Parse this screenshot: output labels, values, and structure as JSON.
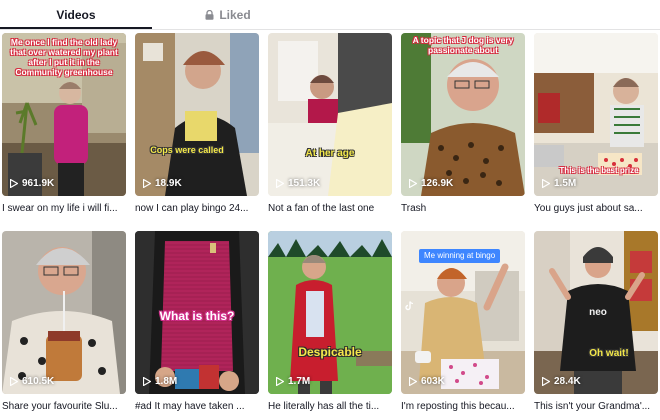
{
  "tabs": {
    "videos_label": "Videos",
    "liked_label": "Liked"
  },
  "colors": {
    "text": "#161823",
    "muted": "#8a8b91",
    "divider": "#e3e3e4",
    "caption_red": "#d6293e",
    "caption_yellow": "#f3e84a",
    "caption_pink": "#d12c8a",
    "pill_blue": "#3e86ff"
  },
  "videos": [
    {
      "caption": "Me once I find the old lady that over watered my plant after I put it in the Community greenhouse",
      "views": "961.9K",
      "title": "I swear on my life i will fi..."
    },
    {
      "caption": "Cops were called",
      "views": "18.9K",
      "title": "now I can play bingo 24..."
    },
    {
      "caption": "At her age",
      "views": "151.3K",
      "title": "Not a fan of the last one"
    },
    {
      "caption": "A topic that J dog is very passionate about",
      "views": "126.9K",
      "title": "Trash"
    },
    {
      "caption": "This is the best prize",
      "views": "1.5M",
      "title": "You guys just about sa..."
    },
    {
      "caption": "",
      "views": "610.5K",
      "title": "Share your favourite Slu..."
    },
    {
      "caption": "What is this?",
      "views": "1.8M",
      "title": "#ad It may have taken ..."
    },
    {
      "caption": "Despicable",
      "views": "1.7M",
      "title": "He literally has all the ti..."
    },
    {
      "caption": "Me winning at bingo",
      "views": "603K",
      "title": "I'm reposting this becau..."
    },
    {
      "caption": "Oh wait!",
      "views": "28.4K",
      "title": "This isn't your Grandma'..."
    }
  ],
  "icons": {
    "lock": "lock-icon",
    "play": "play-icon"
  }
}
